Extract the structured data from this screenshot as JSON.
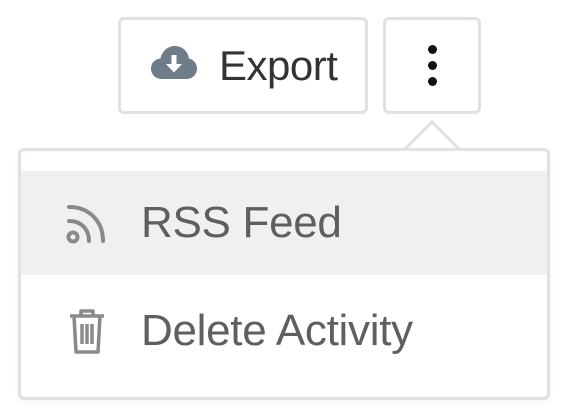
{
  "toolbar": {
    "export_label": "Export",
    "export_icon": "cloud-download-icon",
    "more_icon": "vertical-ellipsis-icon"
  },
  "menu": {
    "items": [
      {
        "label": "RSS Feed",
        "icon": "rss-icon",
        "highlighted": true
      },
      {
        "label": "Delete Activity",
        "icon": "trash-icon",
        "highlighted": false
      }
    ]
  },
  "colors": {
    "border": "#dfe2e5",
    "hover_bg": "#f0f0f0",
    "icon_gray": "#6f7c89",
    "menu_text": "#5f5f5f",
    "button_text": "#333333"
  }
}
